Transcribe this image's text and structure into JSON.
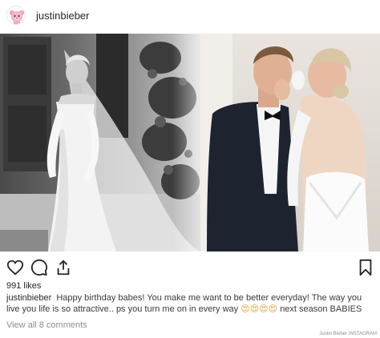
{
  "header": {
    "avatar_icon": "pink-teddy-bear-avatar-icon",
    "username": "justinbieber"
  },
  "photo": {
    "description_icons": [
      "bride-bw-photo",
      "couple-kiss-photo"
    ]
  },
  "actions": {
    "like_icon": "heart-icon",
    "comment_icon": "comment-bubble-icon",
    "share_icon": "share-arrow-icon",
    "save_icon": "bookmark-icon"
  },
  "likes": {
    "text": "991 likes"
  },
  "caption": {
    "username": "justinbieber",
    "text_1": "Happy birthday babes! You make me want to be better everyday! The way you live you life is so attractive.. ps you turn me on in every way",
    "emoji": "😍😍😍😍",
    "text_2": "next season BABIES"
  },
  "comments": {
    "view_all": "View all 8 comments"
  },
  "credit": {
    "text": "Justin Bieber INSTAGRAM"
  },
  "colors": {
    "text": "#262626",
    "muted": "#8e8e8e",
    "avatar_pink": "#f0a8b8"
  }
}
